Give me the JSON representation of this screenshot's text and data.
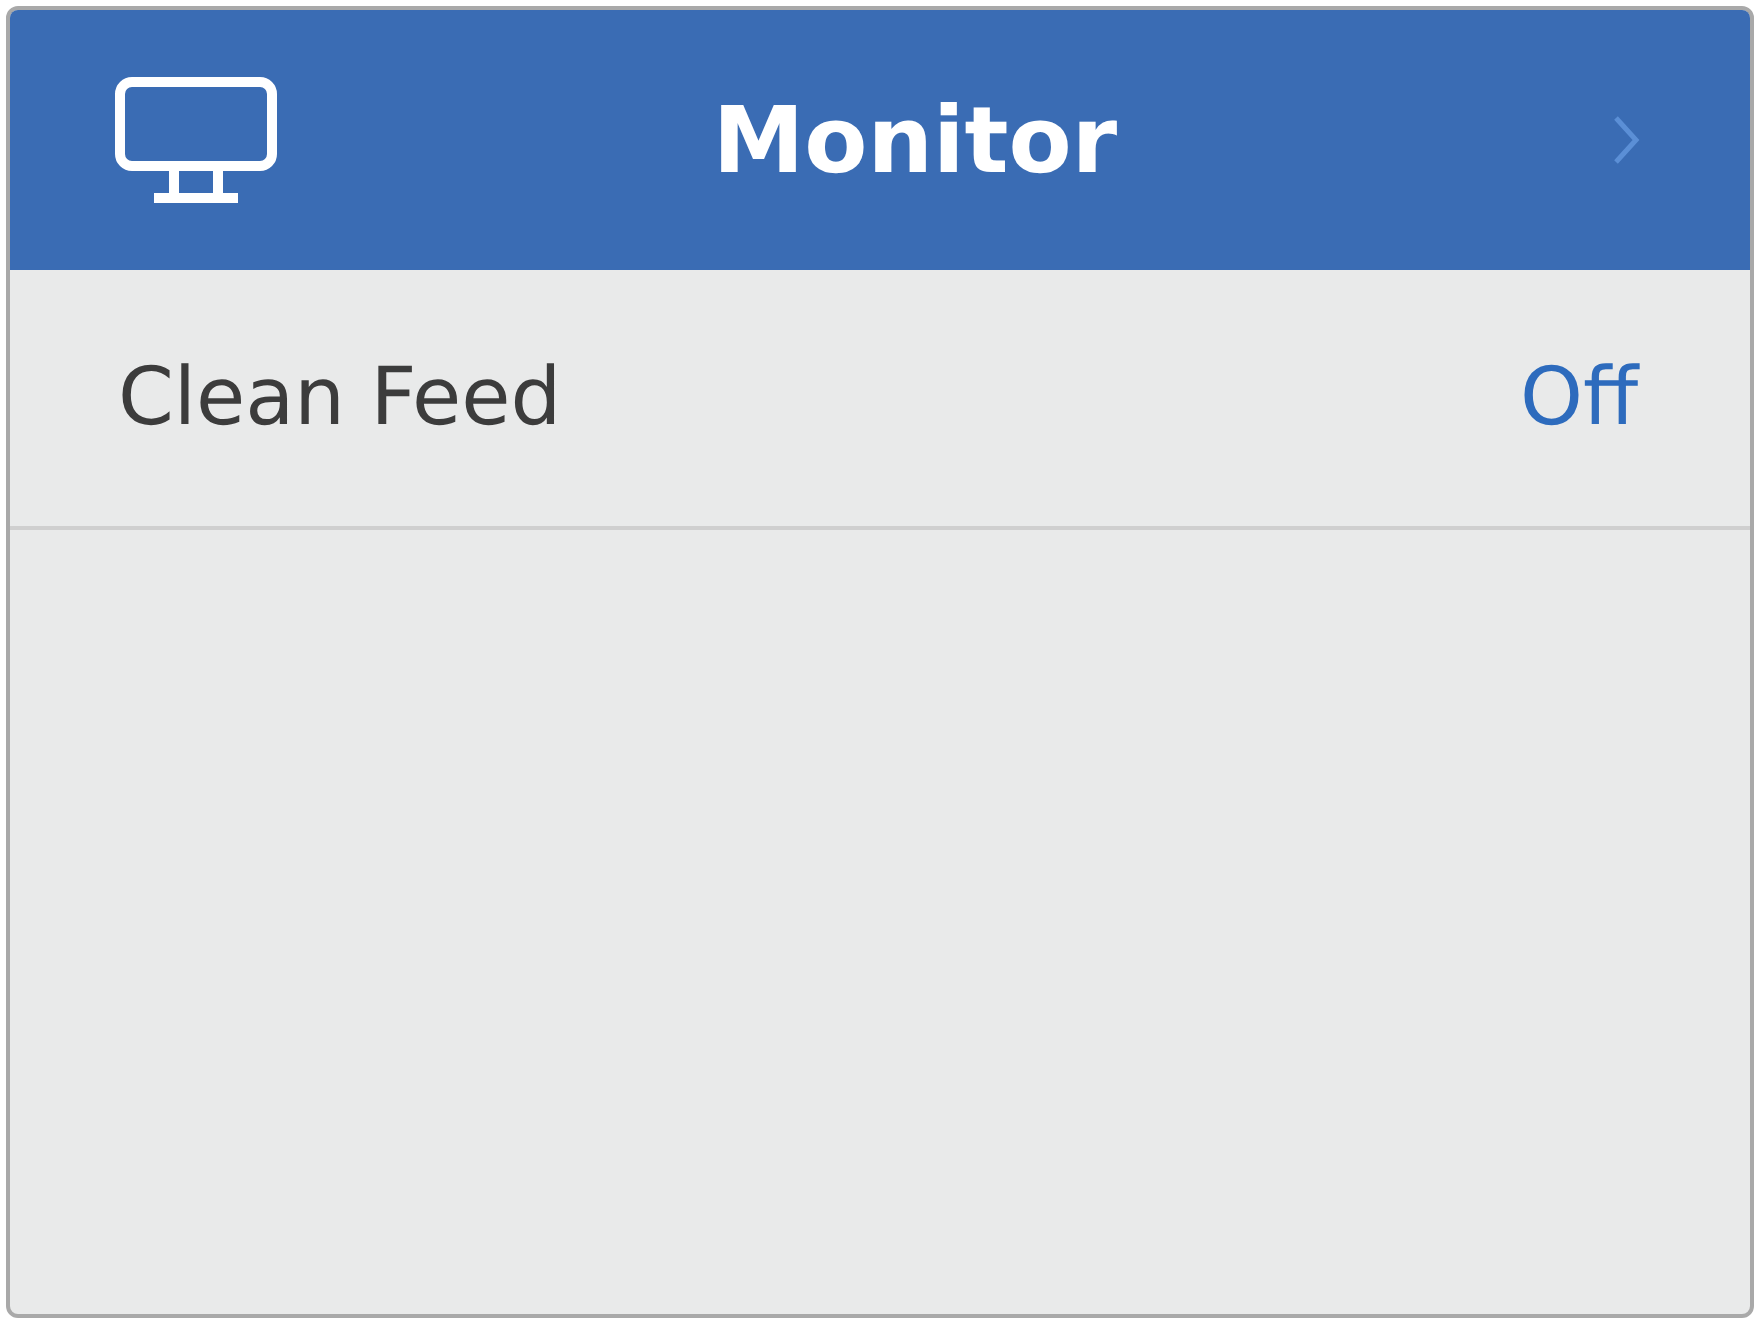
{
  "header": {
    "title": "Monitor"
  },
  "settings": [
    {
      "label": "Clean Feed",
      "value": "Off"
    }
  ]
}
